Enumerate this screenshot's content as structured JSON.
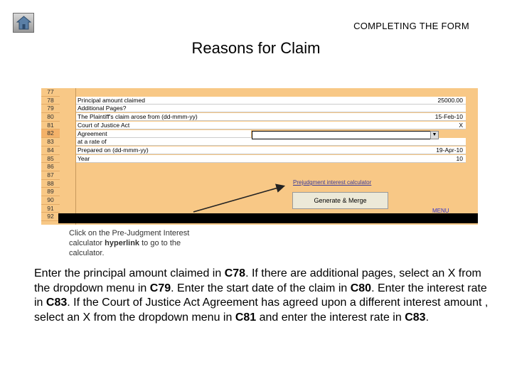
{
  "header": {
    "section": "COMPLETING THE FORM",
    "title": "Reasons for Claim"
  },
  "home_icon": "home-icon",
  "spreadsheet": {
    "row_numbers": [
      "77",
      "78",
      "79",
      "80",
      "81",
      "82",
      "83",
      "84",
      "85",
      "86",
      "87",
      "88",
      "89",
      "90",
      "91",
      "92"
    ],
    "selected_row": "82",
    "rows": [
      {
        "label": "Principal amount claimed",
        "value": "25000.00"
      },
      {
        "label": "Additional Pages?",
        "value": ""
      },
      {
        "label": "The Plaintiff's claim arose from (dd-mmm-yy)",
        "value": "15-Feb-10"
      },
      {
        "label": "   Court of Justice Act",
        "value": "X"
      },
      {
        "label": "   Agreement",
        "value": ""
      },
      {
        "label": "   at a rate of",
        "value": ""
      },
      {
        "label": "Prepared on (dd-mmm-yy)",
        "value": "19-Apr-10"
      },
      {
        "label": "   Year",
        "value": "10"
      }
    ],
    "link_text": "Prejudgment interest calculator",
    "button_label": "Generate & Merge",
    "menu_label": "MENU"
  },
  "callout": {
    "line1": "Click on the Pre-Judgment Interest",
    "line2_pre": "calculator ",
    "line2_bold": "hyperlink",
    "line2_post": " to go to the",
    "line3": "calculator."
  },
  "body": {
    "t1": "Enter the principal amount claimed in ",
    "b1": "C78",
    "t2": ". If there are additional pages, select an X from the dropdown menu in ",
    "b2": "C79",
    "t3": ". Enter the start date of the claim in ",
    "b3": "C80",
    "t4": ". Enter the interest rate in ",
    "b4": "C83",
    "t5": ". If the Court of Justice Act Agreement has agreed upon a different interest amount , select an X from the dropdown menu in ",
    "b5": "C81",
    "t6": " and enter the interest rate in ",
    "b6": "C83",
    "t7": "."
  }
}
